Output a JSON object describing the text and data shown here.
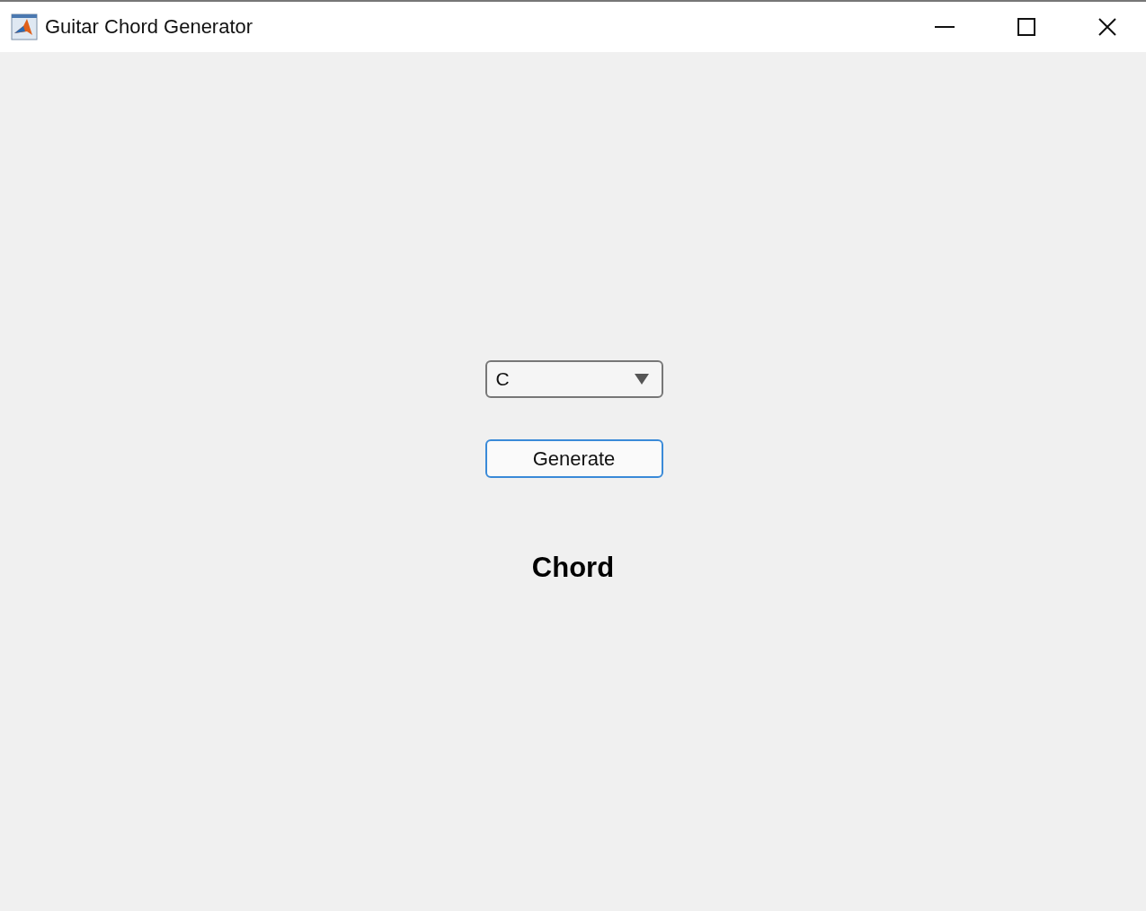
{
  "window": {
    "title": "Guitar Chord Generator"
  },
  "dropdown": {
    "value": "C"
  },
  "button": {
    "label": "Generate"
  },
  "result_label": "Chord"
}
